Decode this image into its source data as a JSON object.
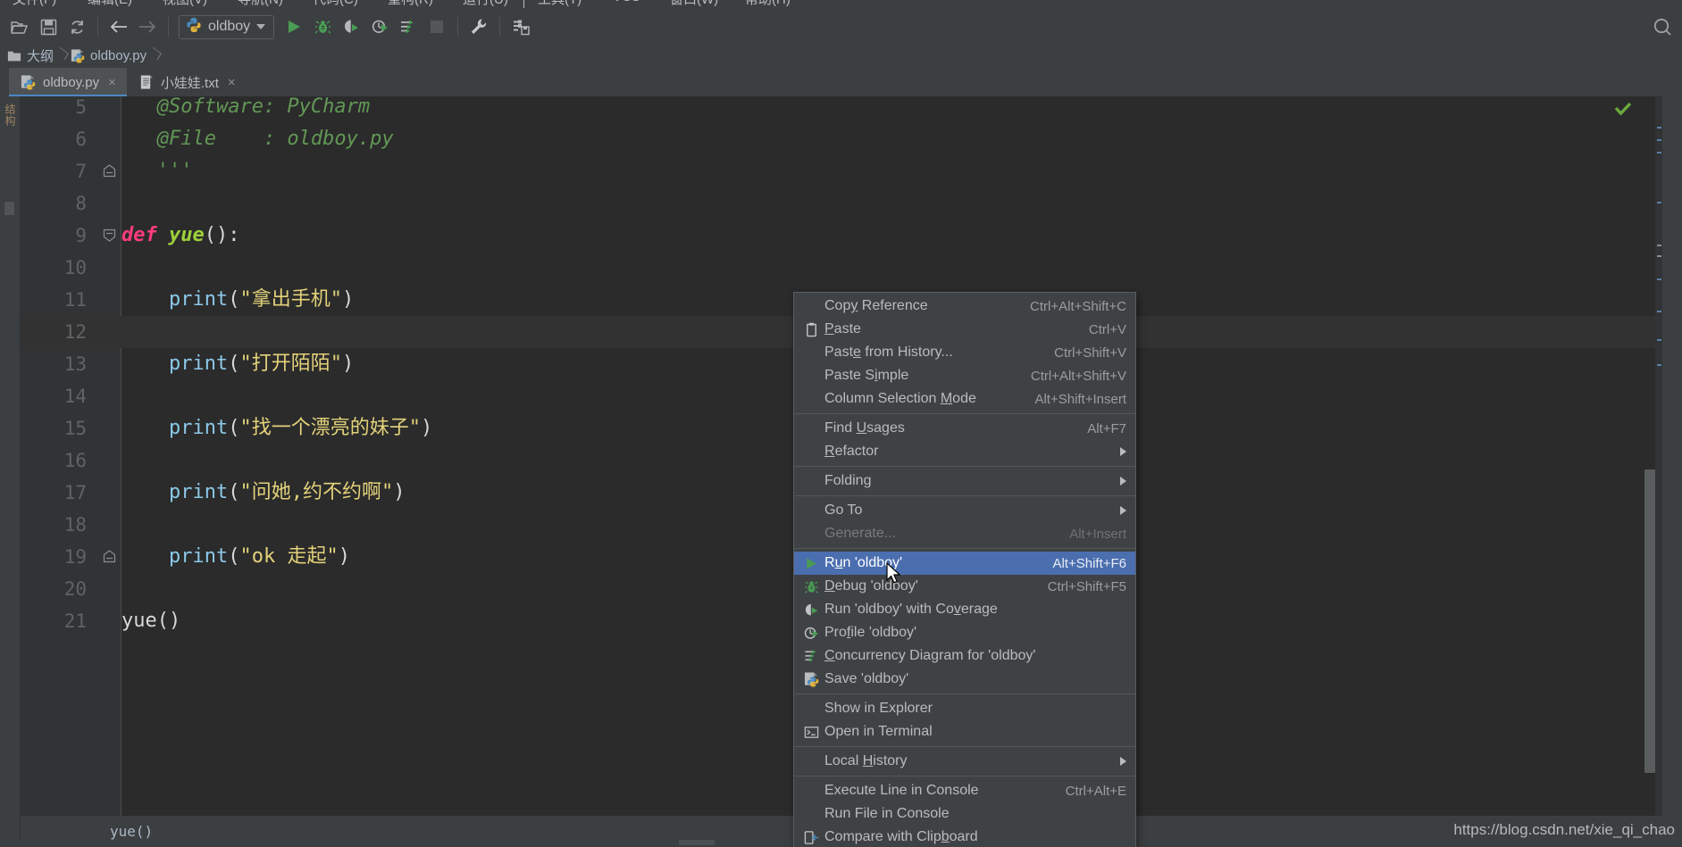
{
  "window": {
    "menubar_items": [
      "文件(F)",
      "编辑(E)",
      "视图(V)",
      "导航(N)",
      "代码(C)",
      "重构(R)",
      "运行(U)",
      "工具(T)",
      "VCS",
      "窗口(W)",
      "帮助(H)"
    ]
  },
  "toolbar": {
    "icons": [
      {
        "name": "open-folder-icon",
        "glyph": "open-folder"
      },
      {
        "name": "save-all-icon",
        "glyph": "floppy"
      },
      {
        "name": "sync-icon",
        "glyph": "refresh"
      },
      {
        "name": "back-icon",
        "glyph": "arrow-left"
      },
      {
        "name": "forward-icon",
        "glyph": "arrow-right"
      }
    ],
    "run_config": {
      "label": "oldboy",
      "icon": "python-file-icon"
    },
    "run_label": "Run",
    "debug_label": "Debug",
    "coverage_label": "Run with Coverage",
    "profile_label": "Profile",
    "concurrency_label": "Concurrency Diagram",
    "stop_label": "Stop",
    "settings_label": "Settings",
    "right_icons": [
      "wrench-icon",
      "project-structure-icon",
      "search-everywhere-icon"
    ]
  },
  "breadcrumb": {
    "items": [
      {
        "label": "大纲",
        "icon": "folder-icon"
      },
      {
        "label": "oldboy.py",
        "icon": "python-file-icon"
      }
    ]
  },
  "tabs": [
    {
      "label": "oldboy.py",
      "icon": "python-file-icon",
      "active": true,
      "close": "×"
    },
    {
      "label": "小娃娃.txt",
      "icon": "text-file-icon",
      "active": false,
      "close": "×"
    }
  ],
  "left_strip": {
    "label": "结构"
  },
  "editor": {
    "first_visible_line": 5,
    "current_line": 12,
    "lines": [
      {
        "num": 5,
        "tokens": [
          {
            "t": "   @Software: PyCharm",
            "c": "tk-com"
          }
        ],
        "fold": null
      },
      {
        "num": 6,
        "tokens": [
          {
            "t": "   @File    : oldboy.py",
            "c": "tk-com"
          }
        ],
        "fold": null
      },
      {
        "num": 7,
        "tokens": [
          {
            "t": "   '''",
            "c": "tk-com"
          }
        ],
        "fold": "end"
      },
      {
        "num": 8,
        "tokens": [],
        "fold": null
      },
      {
        "num": 9,
        "tokens": [
          {
            "t": "def ",
            "c": "tk-kw"
          },
          {
            "t": "yue",
            "c": "tk-fn"
          },
          {
            "t": "():",
            "c": "tk-pl"
          }
        ],
        "fold": "start"
      },
      {
        "num": 10,
        "tokens": [],
        "fold": null
      },
      {
        "num": 11,
        "tokens": [
          {
            "t": "    print",
            "c": "tk-bi"
          },
          {
            "t": "(",
            "c": "tk-pl"
          },
          {
            "t": "\"拿出手机\"",
            "c": "tk-str"
          },
          {
            "t": ")",
            "c": "tk-pl"
          }
        ],
        "fold": null
      },
      {
        "num": 12,
        "tokens": [],
        "fold": null
      },
      {
        "num": 13,
        "tokens": [
          {
            "t": "    print",
            "c": "tk-bi"
          },
          {
            "t": "(",
            "c": "tk-pl"
          },
          {
            "t": "\"打开陌陌\"",
            "c": "tk-str"
          },
          {
            "t": ")",
            "c": "tk-pl"
          }
        ],
        "fold": null
      },
      {
        "num": 14,
        "tokens": [],
        "fold": null
      },
      {
        "num": 15,
        "tokens": [
          {
            "t": "    print",
            "c": "tk-bi"
          },
          {
            "t": "(",
            "c": "tk-pl"
          },
          {
            "t": "\"找一个漂亮的妹子\"",
            "c": "tk-str"
          },
          {
            "t": ")",
            "c": "tk-pl"
          }
        ],
        "fold": null
      },
      {
        "num": 16,
        "tokens": [],
        "fold": null
      },
      {
        "num": 17,
        "tokens": [
          {
            "t": "    print",
            "c": "tk-bi"
          },
          {
            "t": "(",
            "c": "tk-pl"
          },
          {
            "t": "\"问她,约不约啊\"",
            "c": "tk-str"
          },
          {
            "t": ")",
            "c": "tk-pl"
          }
        ],
        "fold": null
      },
      {
        "num": 18,
        "tokens": [],
        "fold": null
      },
      {
        "num": 19,
        "tokens": [
          {
            "t": "    print",
            "c": "tk-bi"
          },
          {
            "t": "(",
            "c": "tk-pl"
          },
          {
            "t": "\"ok 走起\"",
            "c": "tk-str"
          },
          {
            "t": ")",
            "c": "tk-pl"
          }
        ],
        "fold": "end"
      },
      {
        "num": 20,
        "tokens": [],
        "fold": null
      },
      {
        "num": 21,
        "tokens": [
          {
            "t": "yue",
            "c": "tk-id"
          },
          {
            "t": "()",
            "c": "tk-pl"
          }
        ],
        "fold": null
      }
    ],
    "inspection_status": "ok-check",
    "inspection_color": "#6aaa3c"
  },
  "footer": {
    "breadcrumb_label": "yue()",
    "watermark": "https://blog.csdn.net/xie_qi_chao"
  },
  "context_menu": {
    "selected_index": 10,
    "items": [
      {
        "label": "Copy Reference",
        "shortcut": "Ctrl+Alt+Shift+C",
        "icon": null,
        "mnemonic": "y",
        "submenu": false,
        "disabled": false
      },
      {
        "label": "Paste",
        "shortcut": "Ctrl+V",
        "icon": "clipboard-icon",
        "mnemonic": "P",
        "submenu": false,
        "disabled": false
      },
      {
        "label": "Paste from History...",
        "shortcut": "Ctrl+Shift+V",
        "icon": null,
        "mnemonic": "e",
        "submenu": false,
        "disabled": false
      },
      {
        "label": "Paste Simple",
        "shortcut": "Ctrl+Alt+Shift+V",
        "icon": null,
        "mnemonic": "i",
        "submenu": false,
        "disabled": false
      },
      {
        "label": "Column Selection Mode",
        "shortcut": "Alt+Shift+Insert",
        "icon": null,
        "mnemonic": "M",
        "submenu": false,
        "disabled": false
      },
      {
        "separator_after": true,
        "label": "Find Usages",
        "shortcut": "Alt+F7",
        "icon": null,
        "mnemonic": "U",
        "submenu": false,
        "disabled": false
      },
      {
        "label": "Refactor",
        "shortcut": "",
        "icon": null,
        "mnemonic": "R",
        "submenu": true,
        "disabled": false
      },
      {
        "label": "Folding",
        "shortcut": "",
        "icon": null,
        "mnemonic": null,
        "submenu": true,
        "disabled": false
      },
      {
        "label": "Go To",
        "shortcut": "",
        "icon": null,
        "mnemonic": null,
        "submenu": true,
        "disabled": false
      },
      {
        "label": "Generate...",
        "shortcut": "Alt+Insert",
        "icon": null,
        "mnemonic": null,
        "submenu": false,
        "disabled": true
      },
      {
        "label": "Run 'oldboy'",
        "shortcut": "Alt+Shift+F6",
        "icon": "run-icon",
        "mnemonic": "u",
        "submenu": false,
        "disabled": false
      },
      {
        "label": "Debug 'oldboy'",
        "shortcut": "Ctrl+Shift+F5",
        "icon": "debug-icon",
        "mnemonic": "D",
        "submenu": false,
        "disabled": false
      },
      {
        "label": "Run 'oldboy' with Coverage",
        "shortcut": "",
        "icon": "coverage-icon",
        "mnemonic": "v",
        "submenu": false,
        "disabled": false
      },
      {
        "label": "Profile 'oldboy'",
        "shortcut": "",
        "icon": "profile-icon",
        "mnemonic": "f",
        "submenu": false,
        "disabled": false
      },
      {
        "label": "Concurrency Diagram for 'oldboy'",
        "shortcut": "",
        "icon": "concurrency-icon",
        "mnemonic": "C",
        "submenu": false,
        "disabled": false
      },
      {
        "label": "Save 'oldboy'",
        "shortcut": "",
        "icon": "python-file-icon",
        "mnemonic": null,
        "submenu": false,
        "disabled": false
      },
      {
        "label": "Show in Explorer",
        "shortcut": "",
        "icon": null,
        "mnemonic": null,
        "submenu": false,
        "disabled": false
      },
      {
        "label": "Open in Terminal",
        "shortcut": "",
        "icon": "terminal-icon",
        "mnemonic": null,
        "submenu": false,
        "disabled": false
      },
      {
        "label": "Local History",
        "shortcut": "",
        "icon": null,
        "mnemonic": "H",
        "submenu": true,
        "disabled": false
      },
      {
        "label": "Execute Line in Console",
        "shortcut": "Ctrl+Alt+E",
        "icon": null,
        "mnemonic": null,
        "submenu": false,
        "disabled": false
      },
      {
        "label": "Run File in Console",
        "shortcut": "",
        "icon": null,
        "mnemonic": null,
        "submenu": false,
        "disabled": false
      },
      {
        "label": "Compare with Clipboard",
        "shortcut": "",
        "icon": "compare-icon",
        "mnemonic": "b",
        "submenu": false,
        "disabled": false
      }
    ],
    "separators_after": [
      4,
      6,
      7,
      9,
      15,
      17,
      18
    ]
  },
  "colors": {
    "accent": "#4b6eaf",
    "editor_bg": "#2b2b2b",
    "chrome_bg": "#3c3f41",
    "gutter_bg": "#313335",
    "menu_bg": "#3f4244",
    "green": "#499c54",
    "string": "#e3d27a"
  }
}
